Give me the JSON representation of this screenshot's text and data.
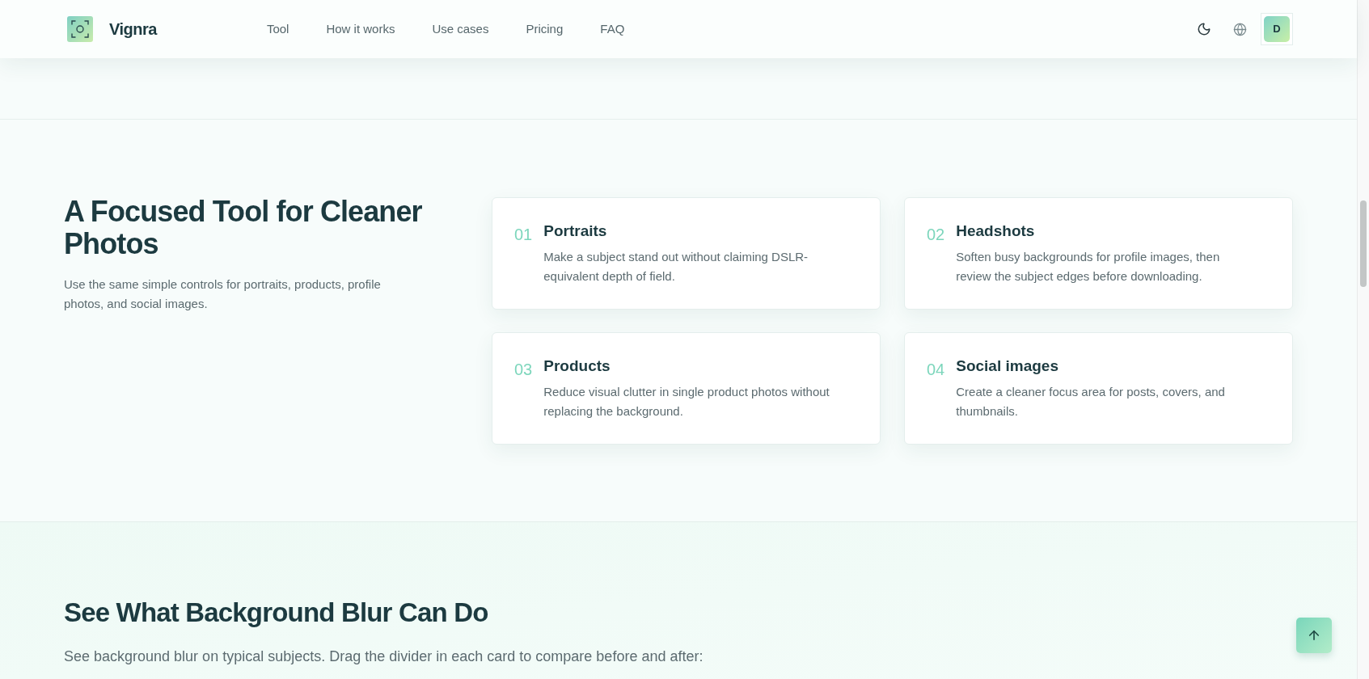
{
  "header": {
    "brand": "Vignra",
    "nav": [
      {
        "label": "Tool"
      },
      {
        "label": "How it works"
      },
      {
        "label": "Use cases"
      },
      {
        "label": "Pricing"
      },
      {
        "label": "FAQ"
      }
    ],
    "avatar": "D"
  },
  "intro": {
    "title": "A Focused Tool for Cleaner Photos",
    "description": "Use the same simple controls for portraits, products, profile photos, and social images."
  },
  "use_cases": [
    {
      "number": "01",
      "title": "Portraits",
      "description": "Make a subject stand out without claiming DSLR-equivalent depth of field."
    },
    {
      "number": "02",
      "title": "Headshots",
      "description": "Soften busy backgrounds for profile images, then review the subject edges before downloading."
    },
    {
      "number": "03",
      "title": "Products",
      "description": "Reduce visual clutter in single product photos without replacing the background."
    },
    {
      "number": "04",
      "title": "Social images",
      "description": "Create a cleaner focus area for posts, covers, and thumbnails."
    }
  ],
  "gallery": {
    "title": "See What Background Blur Can Do",
    "subtitle": "See background blur on typical subjects. Drag the divider in each card to compare before and after:"
  }
}
